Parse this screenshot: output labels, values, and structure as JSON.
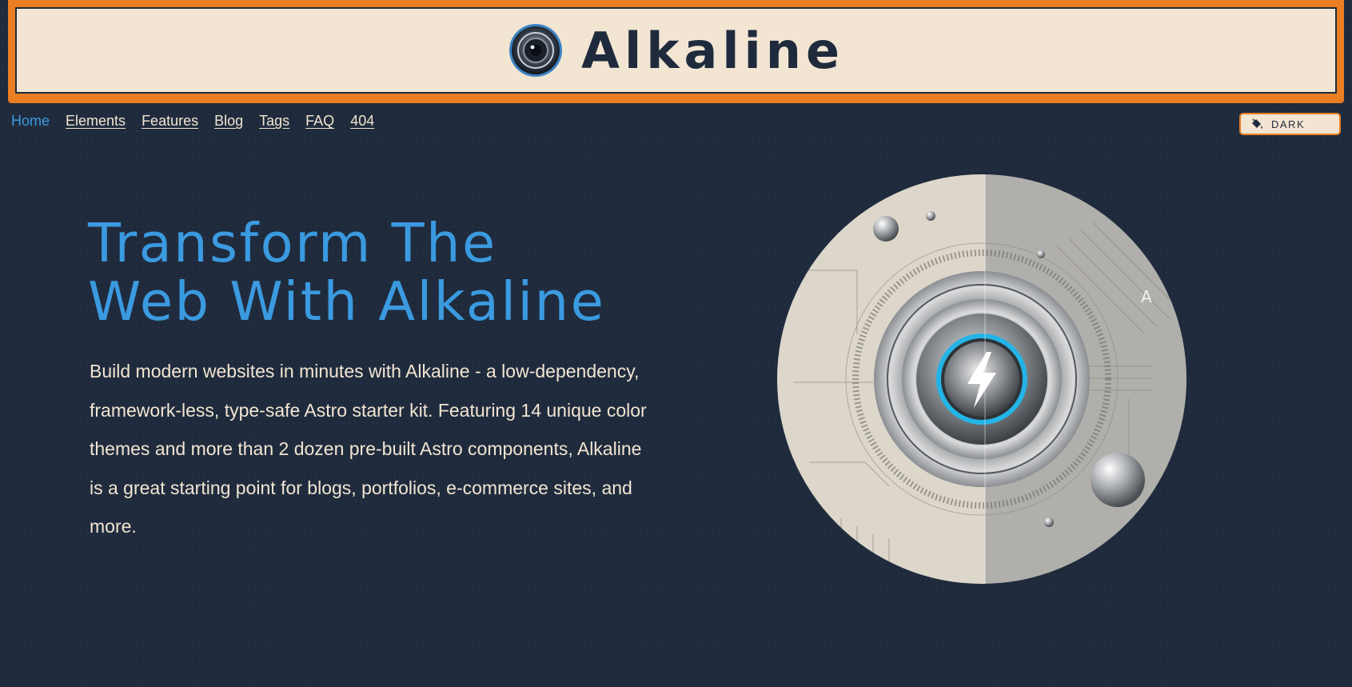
{
  "header": {
    "site_title": "Alkaline",
    "logo_icon": "camera-lens-icon"
  },
  "nav": {
    "items": [
      {
        "label": "Home",
        "active": true
      },
      {
        "label": "Elements",
        "active": false
      },
      {
        "label": "Features",
        "active": false
      },
      {
        "label": "Blog",
        "active": false
      },
      {
        "label": "Tags",
        "active": false
      },
      {
        "label": "FAQ",
        "active": false
      },
      {
        "label": "404",
        "active": false
      }
    ]
  },
  "theme_toggle": {
    "label": "DARK",
    "icon": "paint-bucket-icon"
  },
  "hero": {
    "title_line1": "Transform The",
    "title_line2": "Web With Alkaline",
    "description": "Build modern websites in minutes with Alkaline - a low-dependency, framework-less, type-safe Astro starter kit. Featuring 14 unique color themes and more than 2 dozen pre-built Astro components, Alkaline is a great starting point for blogs, portfolios, e-commerce sites, and more.",
    "image_label": "A"
  },
  "colors": {
    "background": "#1f2b3d",
    "accent": "#3b9ae0",
    "header_border": "#e97e22",
    "header_bg": "#f2e5d2"
  }
}
